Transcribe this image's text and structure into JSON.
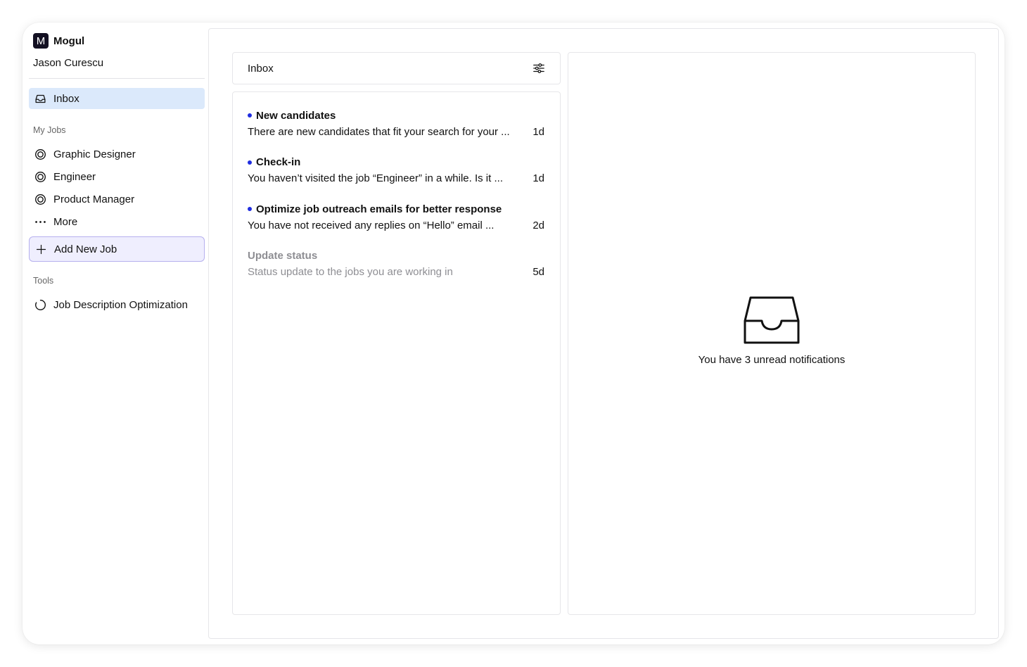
{
  "brand": {
    "logo_letter": "M",
    "name": "Mogul"
  },
  "user": {
    "name": "Jason Curescu"
  },
  "sidebar": {
    "inbox_label": "Inbox",
    "my_jobs_label": "My Jobs",
    "jobs": [
      {
        "label": "Graphic Designer",
        "icon": "target-icon"
      },
      {
        "label": "Engineer",
        "icon": "target-icon"
      },
      {
        "label": "Product Manager",
        "icon": "target-icon"
      }
    ],
    "more_label": "More",
    "add_job_label": "Add New Job",
    "tools_label": "Tools",
    "tools": [
      {
        "label": "Job Description Optimization",
        "icon": "loading-circle-icon"
      }
    ]
  },
  "inbox": {
    "title": "Inbox",
    "notifications": [
      {
        "title": "New candidates",
        "body": "There are new candidates that fit your search for your ...",
        "age": "1d",
        "unread": true
      },
      {
        "title": "Check-in",
        "body": "You haven’t visited the job “Engineer” in a while. Is it ...",
        "age": "1d",
        "unread": true
      },
      {
        "title": "Optimize job outreach emails for better response",
        "body": "You have not received any replies on “Hello” email ...",
        "age": "2d",
        "unread": true
      },
      {
        "title": "Update status",
        "body": "Status update to the jobs you are working in",
        "age": "5d",
        "unread": false
      }
    ]
  },
  "detail": {
    "empty_message": "You have 3 unread notifications"
  },
  "colors": {
    "active_nav_bg": "#dbe9fb",
    "add_job_bg": "#efeefe",
    "add_job_border": "#b6b0ee",
    "unread_dot": "#1f2de0",
    "logo_bg": "#131022"
  }
}
